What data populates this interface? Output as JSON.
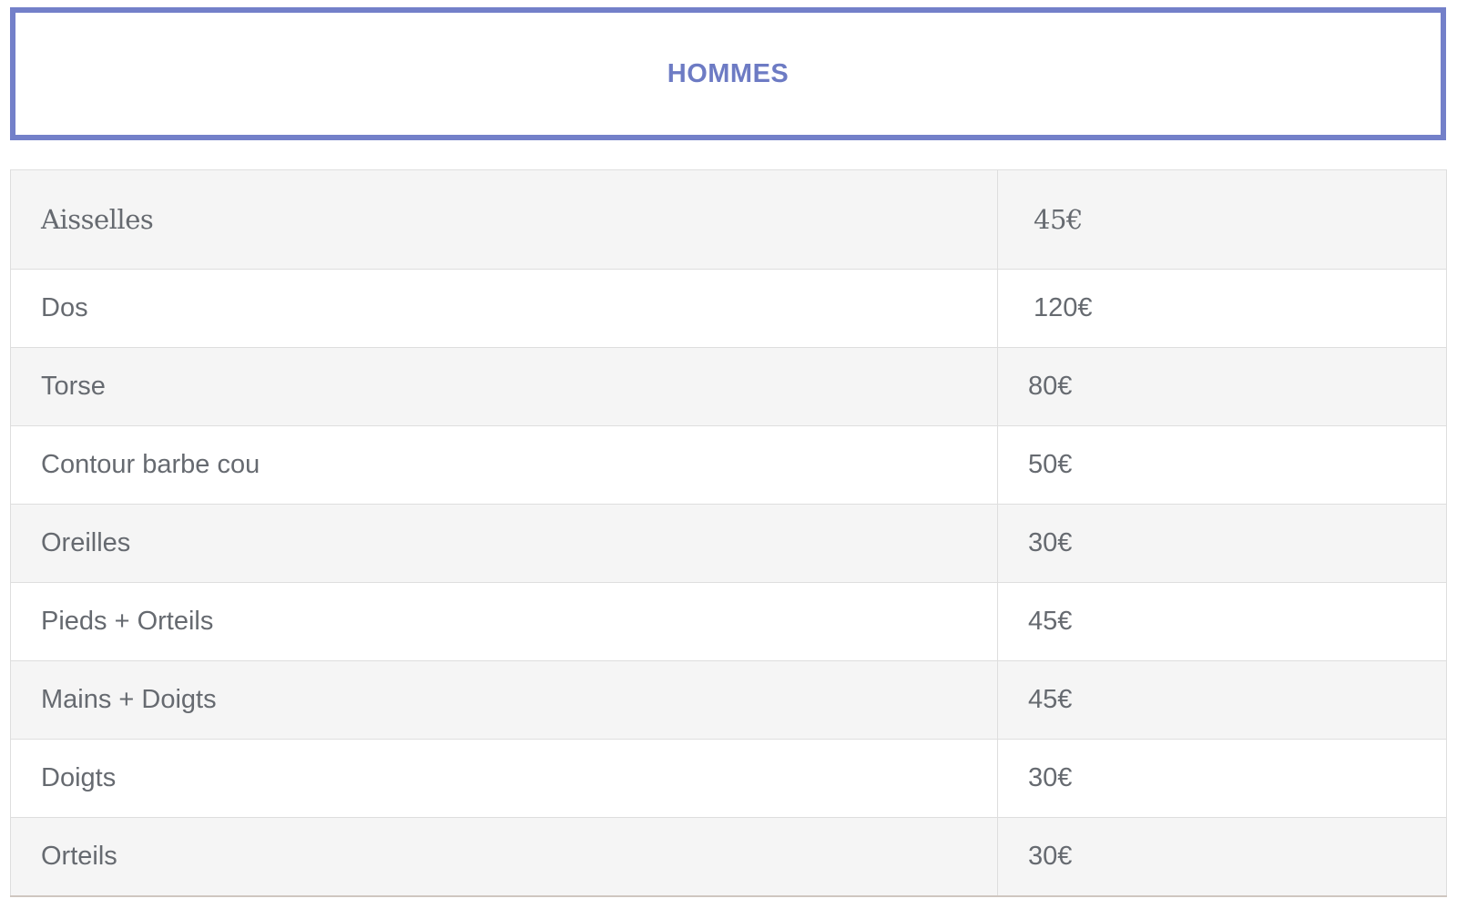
{
  "header": {
    "title": "HOMMES"
  },
  "table": {
    "rows": [
      {
        "service": "Aisselles",
        "price": "45€"
      },
      {
        "service": "Dos",
        "price": "120€"
      },
      {
        "service": "Torse",
        "price": "80€"
      },
      {
        "service": "Contour barbe cou",
        "price": "50€"
      },
      {
        "service": "Oreilles",
        "price": "30€"
      },
      {
        "service": "Pieds + Orteils",
        "price": "45€"
      },
      {
        "service": "Mains + Doigts",
        "price": "45€"
      },
      {
        "service": "Doigts",
        "price": "30€"
      },
      {
        "service": "Orteils",
        "price": "30€"
      }
    ]
  },
  "colors": {
    "accent": "#7380c9",
    "title": "#6d7bc4",
    "text": "#666a70",
    "row_alt": "#f5f5f5",
    "border": "#dedede"
  }
}
